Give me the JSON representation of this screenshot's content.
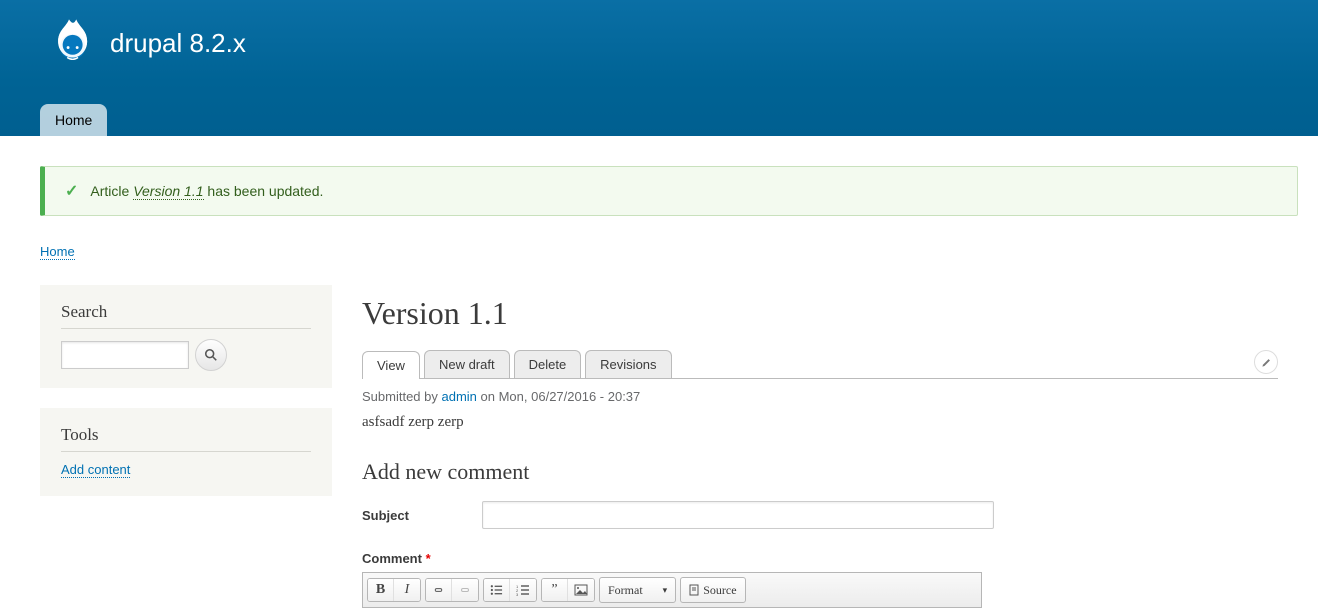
{
  "site": {
    "name": "drupal 8.2.x"
  },
  "menu": {
    "home": "Home"
  },
  "status_message": {
    "prefix": "Article ",
    "link": "Version 1.1",
    "suffix": " has been updated."
  },
  "breadcrumb": {
    "home": "Home"
  },
  "sidebar": {
    "search": {
      "title": "Search"
    },
    "tools": {
      "title": "Tools",
      "add_content": "Add content"
    }
  },
  "content": {
    "title": "Version 1.1",
    "tabs": {
      "view": "View",
      "new_draft": "New draft",
      "delete": "Delete",
      "revisions": "Revisions"
    },
    "submitted": {
      "prefix": "Submitted by ",
      "author": "admin",
      "suffix": " on Mon, 06/27/2016 - 20:37"
    },
    "body": "asfsadf zerp zerp"
  },
  "comments": {
    "heading": "Add new comment",
    "subject_label": "Subject",
    "comment_label": "Comment",
    "required_marker": "*"
  },
  "editor": {
    "format_label": "Format",
    "source_label": "Source"
  }
}
